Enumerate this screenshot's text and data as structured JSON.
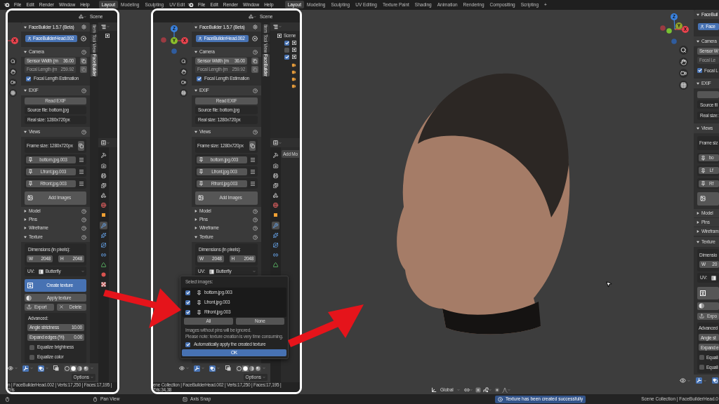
{
  "menubar": {
    "groups": [
      {
        "menus": [
          "File",
          "Edit",
          "Render",
          "Window",
          "Help"
        ],
        "workspaces": [
          {
            "label": "Layout",
            "selected": true
          },
          {
            "label": "Modeling",
            "selected": false
          },
          {
            "label": "Sculpting",
            "selected": false
          },
          {
            "label": "UV Edit",
            "selected": false
          }
        ]
      },
      {
        "menus": [
          "File",
          "Edit",
          "Render",
          "Window",
          "Help"
        ],
        "workspaces": [
          {
            "label": "Layout",
            "selected": true
          },
          {
            "label": "Modeling",
            "selected": false
          },
          {
            "label": "Sculpting",
            "selected": false
          },
          {
            "label": "UV Editing",
            "selected": false
          },
          {
            "label": "Texture Paint",
            "selected": false
          },
          {
            "label": "Shading",
            "selected": false
          },
          {
            "label": "Animation",
            "selected": false
          },
          {
            "label": "Rendering",
            "selected": false
          },
          {
            "label": "Compositing",
            "selected": false
          },
          {
            "label": "Scripting",
            "selected": false
          }
        ],
        "add": "+"
      }
    ]
  },
  "insets": [
    {
      "scene": "Scene",
      "gizmo": {
        "x": "X"
      },
      "panel": {
        "trailing_icons": true,
        "rows": [
          {
            "kind": "title",
            "text": "FaceBuilder 1.5.7 (Beta)",
            "expanded": true
          },
          {
            "kind": "head",
            "text": "FaceBuilderHead.002"
          },
          {
            "kind": "section",
            "text": "Camera",
            "expanded": true
          },
          {
            "kind": "field",
            "label": "Sensor Width (m",
            "value": "36.00",
            "disabled": false
          },
          {
            "kind": "field",
            "label": "Focal Length (m",
            "value": "259.92",
            "disabled": true
          },
          {
            "kind": "check",
            "label": "Focal Length Estimation",
            "checked": true
          },
          {
            "kind": "section",
            "text": "EXIF",
            "expanded": true
          },
          {
            "kind": "button",
            "label": "Read EXIF"
          },
          {
            "kind": "info",
            "text": "Source file: bottom.jpg"
          },
          {
            "kind": "info",
            "text": "Real size: 1280x720px"
          },
          {
            "kind": "section",
            "text": "Views",
            "expanded": true
          },
          {
            "kind": "frame",
            "text": "Frame size: 1280x720px"
          },
          {
            "kind": "view",
            "text": "bottom.jpg.003"
          },
          {
            "kind": "view",
            "text": "Lfront.jpg.003"
          },
          {
            "kind": "view",
            "text": "Rfront.jpg.003"
          },
          {
            "kind": "add_images",
            "label": "Add Images"
          },
          {
            "kind": "section",
            "text": "Model",
            "expanded": false
          },
          {
            "kind": "section",
            "text": "Pins",
            "expanded": false
          },
          {
            "kind": "section",
            "text": "Wireframe",
            "expanded": false
          },
          {
            "kind": "section",
            "text": "Texture",
            "expanded": true
          },
          {
            "kind": "dimensions",
            "text": "Dimensions (in pixels):",
            "fields": [
              {
                "label": "W",
                "value": "2048"
              },
              {
                "label": "H",
                "value": "2048"
              }
            ]
          },
          {
            "kind": "uv",
            "label": "UV:",
            "value": "Butterfly"
          },
          {
            "kind": "create",
            "label": "Create texture",
            "highlighted": true
          },
          {
            "kind": "apply",
            "label": "Apply texture"
          },
          {
            "kind": "export_delete",
            "buttons": [
              "Export",
              "Delete"
            ]
          },
          {
            "kind": "advanced",
            "text": "Advanced:",
            "fields": [
              {
                "label": "Angle strictness",
                "value": "10.00"
              },
              {
                "label": "Expand edges (%)",
                "value": "0.00"
              }
            ],
            "checks": [
              {
                "label": "Equalize brightness",
                "checked": false
              },
              {
                "label": "Equalize color",
                "checked": false
              }
            ]
          }
        ]
      },
      "tabs": [
        {
          "label": "Item",
          "selected": false
        },
        {
          "label": "Tool",
          "selected": false
        },
        {
          "label": "View",
          "selected": false
        },
        {
          "label": "FaceBuilder",
          "selected": true
        }
      ],
      "properties": {
        "tabs": [
          {
            "selected": false
          },
          {
            "selected": false
          },
          {
            "selected": false
          },
          {
            "selected": false
          },
          {
            "selected": false
          },
          {
            "selected": false
          },
          {
            "selected": false
          },
          {
            "selected": true
          },
          {
            "selected": false
          },
          {
            "selected": false
          },
          {
            "selected": false
          },
          {
            "selected": false
          },
          {
            "selected": false
          },
          {
            "selected": false
          }
        ]
      },
      "toolbar": {
        "gizmos": true,
        "overlays": true,
        "shading": [
          {
            "selected": false
          },
          {
            "selected": true
          },
          {
            "selected": false
          },
          {
            "selected": false
          }
        ],
        "options": "Options"
      },
      "status": "n | FaceBuilderHead.002 | Verts:17,250 | Faces:17,195 | Tris"
    },
    {
      "scene": "Scene",
      "gizmo": {
        "x": "X",
        "y": "Y",
        "z": "Z"
      },
      "panel": {
        "trailing_icons": true,
        "rows": [
          {
            "kind": "title",
            "text": "FaceBuilder 1.5.7 (Beta)",
            "expanded": true
          },
          {
            "kind": "head",
            "text": "FaceBuilderHead.002"
          },
          {
            "kind": "section",
            "text": "Camera",
            "expanded": true
          },
          {
            "kind": "field",
            "label": "Sensor Width (m",
            "value": "36.00",
            "disabled": false
          },
          {
            "kind": "field",
            "label": "Focal Length (m",
            "value": "259.92",
            "disabled": true
          },
          {
            "kind": "check",
            "label": "Focal Length Estimation",
            "checked": true
          },
          {
            "kind": "section",
            "text": "EXIF",
            "expanded": true
          },
          {
            "kind": "button",
            "label": "Read EXIF"
          },
          {
            "kind": "info",
            "text": "Source file: bottom.jpg"
          },
          {
            "kind": "info",
            "text": "Real size: 1280x720px"
          },
          {
            "kind": "section",
            "text": "Views",
            "expanded": true
          },
          {
            "kind": "frame",
            "text": "Frame size: 1280x720px"
          },
          {
            "kind": "view",
            "text": "bottom.jpg.003"
          },
          {
            "kind": "view",
            "text": "Lfront.jpg.003"
          },
          {
            "kind": "view",
            "text": "Rfront.jpg.003"
          },
          {
            "kind": "add_images",
            "label": "Add Images"
          },
          {
            "kind": "section",
            "text": "Model",
            "expanded": false
          },
          {
            "kind": "section",
            "text": "Pins",
            "expanded": false
          },
          {
            "kind": "section",
            "text": "Wireframe",
            "expanded": false
          },
          {
            "kind": "section",
            "text": "Texture",
            "expanded": true
          },
          {
            "kind": "dimensions",
            "text": "Dimensions (in pixels):",
            "fields": [
              {
                "label": "W",
                "value": "2048"
              },
              {
                "label": "H",
                "value": "2048"
              }
            ]
          },
          {
            "kind": "uv",
            "label": "UV:",
            "value": "Butterfly"
          }
        ]
      },
      "tabs": [
        {
          "label": "Item",
          "selected": false
        },
        {
          "label": "Tool",
          "selected": false
        },
        {
          "label": "View",
          "selected": false
        },
        {
          "label": "FaceBuilder",
          "selected": true
        }
      ],
      "outliner": {
        "collection": "Scene",
        "rows": [
          {
            "checked": true
          },
          {
            "checked": false
          },
          {
            "checked": true
          }
        ]
      },
      "properties": {
        "button": "Add Mo",
        "tabs": [
          {
            "selected": false
          },
          {
            "selected": false
          },
          {
            "selected": false
          },
          {
            "selected": false
          },
          {
            "selected": false
          },
          {
            "selected": false
          },
          {
            "selected": false
          },
          {
            "selected": true
          },
          {
            "selected": false
          },
          {
            "selected": false
          },
          {
            "selected": false
          },
          {
            "selected": false
          }
        ]
      },
      "toolbar": {
        "gizmos": true,
        "overlays": true,
        "shading": [
          {
            "selected": false
          },
          {
            "selected": true
          },
          {
            "selected": false
          },
          {
            "selected": false
          }
        ],
        "options": "Options"
      },
      "status": "ene Collection | FaceBuilderHead.002 | Verts:17,250 | Faces:17,195 | Tris:34,38",
      "popup": {
        "title": "Select images:",
        "images": [
          {
            "name": "bottom.jpg.003",
            "checked": true
          },
          {
            "name": "Lfront.jpg.003",
            "checked": true
          },
          {
            "name": "Rfront.jpg.003",
            "checked": true
          }
        ],
        "buttons": [
          "All",
          "None"
        ],
        "notes": [
          "Images without pins will be ignored.",
          "Please note: texture creation is very time consuming."
        ],
        "auto_apply": {
          "label": "Automatically apply the created texture",
          "checked": true
        },
        "ok": "OK"
      }
    }
  ],
  "viewport": {
    "gizmo": {
      "x": "X",
      "y": "Y",
      "z": "Z"
    },
    "header": {
      "orientation": "Global"
    },
    "toolbar": {
      "gizmos": true,
      "overlays": true
    }
  },
  "sidebar": {
    "trailing_icons": false,
    "rows": [
      {
        "kind": "title",
        "text": "FaceBuil",
        "expanded": true
      },
      {
        "kind": "head",
        "text": "Face"
      },
      {
        "kind": "section",
        "text": "Camera",
        "expanded": true
      },
      {
        "kind": "field",
        "label": "Sensor W",
        "disabled": false
      },
      {
        "kind": "field",
        "label": "Focal Le",
        "disabled": true
      },
      {
        "kind": "check",
        "label": "Focal L",
        "checked": true
      },
      {
        "kind": "section",
        "text": "EXIF",
        "expanded": true
      },
      {
        "kind": "button"
      },
      {
        "kind": "info",
        "text": "Source fil"
      },
      {
        "kind": "info",
        "text": "Real size:"
      },
      {
        "kind": "section",
        "text": "Views",
        "expanded": true
      },
      {
        "kind": "frame",
        "text": "Frame siz"
      },
      {
        "kind": "view",
        "text": "bo"
      },
      {
        "kind": "view",
        "text": "Lf"
      },
      {
        "kind": "view",
        "text": "Rf"
      },
      {
        "kind": "add_images"
      },
      {
        "kind": "section",
        "text": "Model",
        "expanded": false
      },
      {
        "kind": "section",
        "text": "Pins",
        "expanded": false
      },
      {
        "kind": "section",
        "text": "Wirefram",
        "expanded": false
      },
      {
        "kind": "section",
        "text": "Texture",
        "expanded": true
      },
      {
        "kind": "dimensions",
        "text": "Dimensio",
        "fields": [
          {
            "label": "W",
            "value": "20"
          }
        ]
      },
      {
        "kind": "uv",
        "label": "UV:"
      },
      {
        "kind": "create",
        "highlighted": false
      },
      {
        "kind": "apply"
      },
      {
        "kind": "export_delete",
        "buttons": [
          "Expo"
        ]
      },
      {
        "kind": "advanced",
        "text": "Advanced",
        "fields": [
          {
            "label": "Angle st"
          },
          {
            "label": "Expand e"
          }
        ],
        "checks": [
          {
            "label": "Equali",
            "checked": false
          },
          {
            "label": "Equali",
            "checked": false
          }
        ]
      }
    ]
  },
  "status_bar": {
    "hints": [
      "Pan View",
      "Axis Snap"
    ],
    "notification": "Texture has been created successfully",
    "stats": "Scene Collection | FaceBuilderHead.0"
  }
}
